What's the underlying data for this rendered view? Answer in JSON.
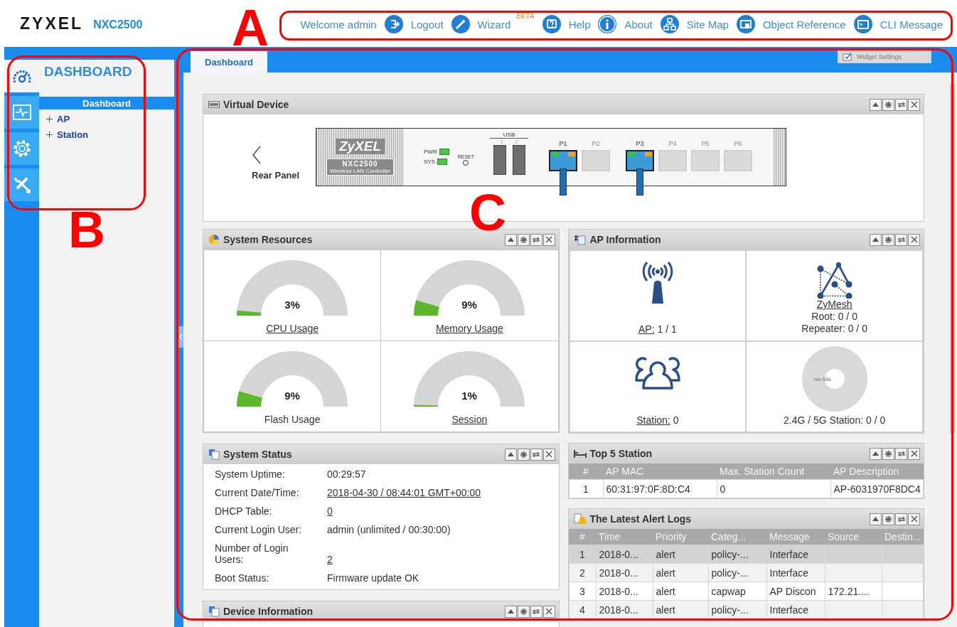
{
  "header": {
    "brand": "ZYXEL",
    "model": "NXC2500",
    "links": [
      {
        "kind": "text",
        "label": "Welcome admin"
      },
      {
        "kind": "logout",
        "label": "Logout"
      },
      {
        "kind": "wizard",
        "label": "Wizard",
        "badge": "BETA"
      },
      {
        "kind": "help",
        "label": "Help"
      },
      {
        "kind": "about",
        "label": "About"
      },
      {
        "kind": "sitemap",
        "label": "Site Map"
      },
      {
        "kind": "object",
        "label": "Object Reference"
      },
      {
        "kind": "cli",
        "label": "CLI Message"
      }
    ]
  },
  "sidebar": {
    "title": "DASHBOARD",
    "rail": [
      {
        "kind": "dashboard",
        "selected": true
      },
      {
        "kind": "monitor",
        "selected": false
      },
      {
        "kind": "configuration",
        "selected": false
      },
      {
        "kind": "maintenance",
        "selected": false
      }
    ],
    "items": [
      {
        "label": "Dashboard",
        "selected": true,
        "expandable": false
      },
      {
        "label": "AP",
        "selected": false,
        "expandable": true
      },
      {
        "label": "Station",
        "selected": false,
        "expandable": true
      }
    ]
  },
  "tabs": [
    {
      "label": "Dashboard",
      "selected": true
    }
  ],
  "widget_settings": "Widget Settings",
  "virtual_device": {
    "title": "Virtual Device",
    "back_label": "Rear Panel",
    "device": {
      "brand": "ZyXEL",
      "model": "NXC2500",
      "subtitle": "Wireless LAN Controller",
      "leds": [
        {
          "label": "PWR",
          "on": true
        },
        {
          "label": "SYS",
          "on": true
        }
      ],
      "reset": "RESET",
      "usb_label": "USB",
      "usb_ports": [
        "1",
        "2"
      ],
      "ports": [
        {
          "label": "P1",
          "connected": true
        },
        {
          "label": "P2",
          "connected": false
        },
        {
          "label": "P3",
          "connected": true
        },
        {
          "label": "P4",
          "connected": false
        },
        {
          "label": "P5",
          "connected": false
        },
        {
          "label": "P6",
          "connected": false
        }
      ]
    }
  },
  "system_resources": {
    "title": "System Resources",
    "gauges": [
      {
        "label": "CPU Usage",
        "reading": "3%",
        "level": 0.03,
        "link": true
      },
      {
        "label": "Memory Usage",
        "reading": "9%",
        "level": 0.09,
        "link": true
      },
      {
        "label": "Flash Usage",
        "reading": "9%",
        "level": 0.09,
        "link": false
      },
      {
        "label": "Session",
        "reading": "1%",
        "level": 0.01,
        "link": true
      }
    ]
  },
  "ap_information": {
    "title": "AP Information",
    "cells": [
      {
        "kind": "ap",
        "link": "AP:",
        "value": "1 / 1"
      },
      {
        "kind": "zymesh",
        "link": "ZyMesh",
        "lines": [
          "Root: 0 / 0",
          "Repeater: 0 / 0"
        ]
      },
      {
        "kind": "station",
        "link": "Station:",
        "value": "0"
      },
      {
        "kind": "band",
        "chart_label": "no-Sta",
        "text": "2.4G / 5G Station: 0 / 0"
      }
    ]
  },
  "system_status": {
    "title": "System Status",
    "rows": [
      {
        "label": "System Uptime:",
        "value": "00:29:57",
        "link": false
      },
      {
        "label": "Current Date/Time:",
        "value": "2018-04-30 / 08:44:01 GMT+00:00",
        "link": true
      },
      {
        "label": "DHCP Table:",
        "value": "0",
        "link": true
      },
      {
        "label": "Current Login User:",
        "value": "admin (unlimited / 00:30:00)",
        "link": false
      },
      {
        "label": "Number of Login Users:",
        "value": "2",
        "link": true
      },
      {
        "label": "Boot Status:",
        "value": "Firmware update OK",
        "link": false
      }
    ]
  },
  "device_information": {
    "title": "Device Information"
  },
  "top_5_station": {
    "title": "Top 5 Station",
    "columns": [
      "#",
      "AP MAC",
      "Max. Station Count",
      "AP Description"
    ],
    "rows": [
      [
        "1",
        "60:31:97:0F:8D:C4",
        "0",
        "AP-6031970F8DC4"
      ]
    ]
  },
  "alert_logs": {
    "title": "The Latest Alert Logs",
    "columns": [
      "#",
      "Time",
      "Priority",
      "Categ...",
      "Message",
      "Source",
      "Destin..."
    ],
    "rows": [
      {
        "selected": true,
        "cells": [
          "1",
          "2018-0...",
          "alert",
          "policy-...",
          "Interface",
          "",
          ""
        ]
      },
      {
        "selected": false,
        "cells": [
          "2",
          "2018-0...",
          "alert",
          "policy-...",
          "Interface",
          "",
          ""
        ]
      },
      {
        "selected": false,
        "cells": [
          "3",
          "2018-0...",
          "alert",
          "capwap",
          "AP Discon",
          "172.21....",
          ""
        ]
      },
      {
        "selected": false,
        "cells": [
          "4",
          "2018-0...",
          "alert",
          "policy-...",
          "Interface",
          "",
          ""
        ]
      }
    ]
  },
  "annotations": [
    {
      "label": "A"
    },
    {
      "label": "B"
    },
    {
      "label": "C"
    }
  ]
}
